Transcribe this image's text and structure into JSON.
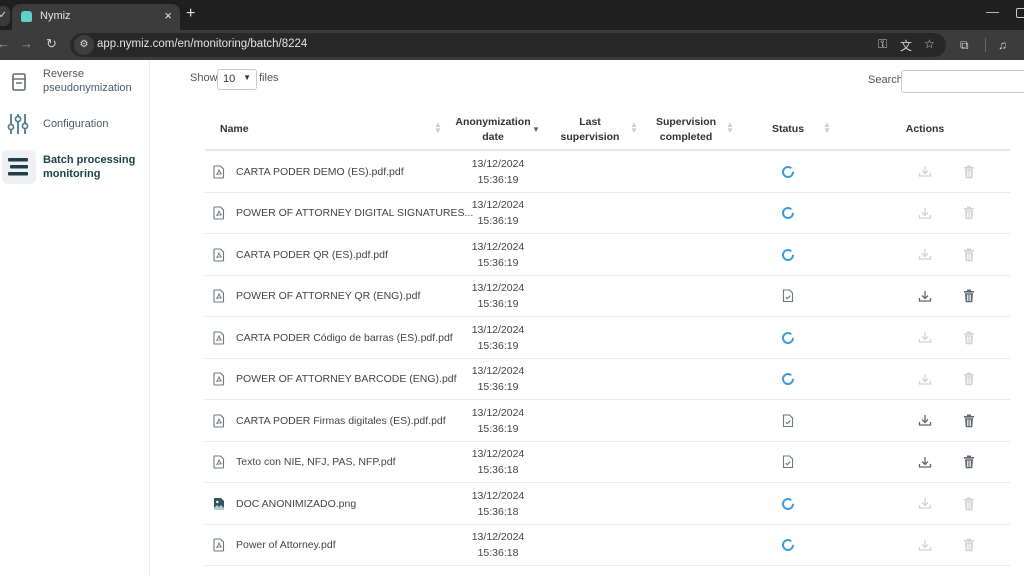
{
  "browser": {
    "tab_title": "Nymiz",
    "tab_close": "×",
    "new_tab": "+",
    "url": "app.nymiz.com/en/monitoring/batch/8224",
    "icons": [
      "key-icon",
      "translate-icon",
      "star-icon",
      "extensions-icon",
      "media-icon"
    ]
  },
  "sidebar": {
    "items": [
      {
        "label": "Reverse pseudonymization",
        "icon": "document-icon",
        "active": false
      },
      {
        "label": "Configuration",
        "icon": "sliders-icon",
        "active": false
      },
      {
        "label": "Batch processing monitoring",
        "icon": "menu-bars-icon",
        "active": true
      }
    ]
  },
  "controls": {
    "show_label": "Show",
    "page_size": "10",
    "files_label": "files",
    "search_label": "Search",
    "search_value": ""
  },
  "table": {
    "columns": [
      {
        "label": "Name",
        "sort": "none"
      },
      {
        "label": "Anonymization date",
        "sort": "desc"
      },
      {
        "label": "Last supervision",
        "sort": "none"
      },
      {
        "label": "Supervision completed",
        "sort": "none"
      },
      {
        "label": "Status",
        "sort": "none"
      },
      {
        "label": "Actions",
        "sort": null
      }
    ],
    "rows": [
      {
        "name": "CARTA PODER DEMO (ES).pdf.pdf",
        "type": "pdf",
        "date": "13/12/2024",
        "time": "15:36:19",
        "last_supervision": "",
        "supervision_completed": "",
        "status": "processing",
        "actions_enabled": false
      },
      {
        "name": "POWER OF ATTORNEY DIGITAL SIGNATURES...",
        "type": "pdf",
        "date": "13/12/2024",
        "time": "15:36:19",
        "last_supervision": "",
        "supervision_completed": "",
        "status": "processing",
        "actions_enabled": false
      },
      {
        "name": "CARTA PODER QR (ES).pdf.pdf",
        "type": "pdf",
        "date": "13/12/2024",
        "time": "15:36:19",
        "last_supervision": "",
        "supervision_completed": "",
        "status": "processing",
        "actions_enabled": false
      },
      {
        "name": "POWER OF ATTORNEY QR (ENG).pdf",
        "type": "pdf",
        "date": "13/12/2024",
        "time": "15:36:19",
        "last_supervision": "",
        "supervision_completed": "",
        "status": "completed",
        "actions_enabled": true
      },
      {
        "name": "CARTA PODER Código de barras (ES).pdf.pdf",
        "type": "pdf",
        "date": "13/12/2024",
        "time": "15:36:19",
        "last_supervision": "",
        "supervision_completed": "",
        "status": "processing",
        "actions_enabled": false
      },
      {
        "name": "POWER OF ATTORNEY BARCODE (ENG).pdf",
        "type": "pdf",
        "date": "13/12/2024",
        "time": "15:36:19",
        "last_supervision": "",
        "supervision_completed": "",
        "status": "processing",
        "actions_enabled": false
      },
      {
        "name": "CARTA PODER Firmas digitales (ES).pdf.pdf",
        "type": "pdf",
        "date": "13/12/2024",
        "time": "15:36:19",
        "last_supervision": "",
        "supervision_completed": "",
        "status": "completed",
        "actions_enabled": true
      },
      {
        "name": "Texto con NIE, NFJ, PAS, NFP.pdf",
        "type": "pdf",
        "date": "13/12/2024",
        "time": "15:36:18",
        "last_supervision": "",
        "supervision_completed": "",
        "status": "completed",
        "actions_enabled": true
      },
      {
        "name": "DOC ANONIMIZADO.png",
        "type": "image",
        "date": "13/12/2024",
        "time": "15:36:18",
        "last_supervision": "",
        "supervision_completed": "",
        "status": "processing",
        "actions_enabled": false
      },
      {
        "name": "Power of Attorney.pdf",
        "type": "pdf",
        "date": "13/12/2024",
        "time": "15:36:18",
        "last_supervision": "",
        "supervision_completed": "",
        "status": "processing",
        "actions_enabled": false
      }
    ]
  },
  "colors": {
    "spinner": "#3b9ae1",
    "active_nav": "#1e3e4a",
    "disabled_icon": "#cfd3d6",
    "enabled_icon": "#5c6870"
  }
}
